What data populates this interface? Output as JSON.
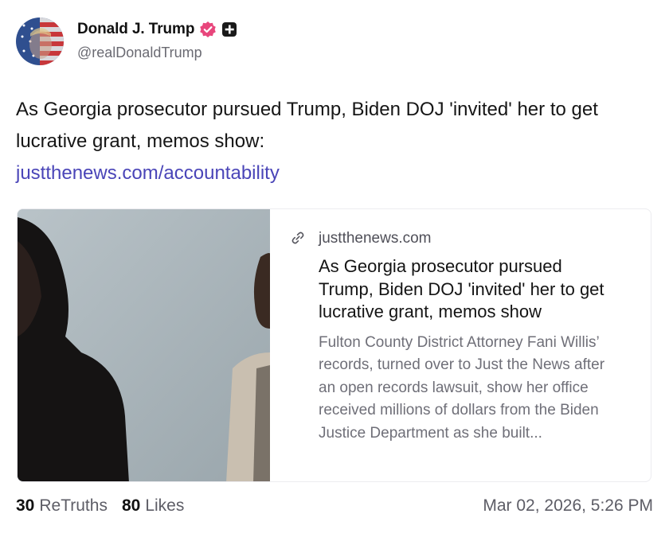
{
  "author": {
    "display_name": "Donald J. Trump",
    "handle": "@realDonaldTrump"
  },
  "post": {
    "text": "As Georgia prosecutor pursued Trump, Biden DOJ 'invited' her to get lucrative grant, memos show:",
    "link": "justthenews.com/accountability"
  },
  "card": {
    "domain": "justthenews.com",
    "title": "As Georgia prosecutor pursued Trump, Biden DOJ 'invited' her to get lucrative grant, memos show",
    "description": "Fulton County District Attorney Fani Willis’ records, turned over to Just the News after an open records lawsuit, show her office received millions of dollars from the Biden Justice Department as she built..."
  },
  "stats": {
    "retruths_count": "30",
    "retruths_label": "ReTruths",
    "likes_count": "80",
    "likes_label": "Likes"
  },
  "timestamp": "Mar 02, 2026, 5:26 PM",
  "colors": {
    "link": "#4a45b8",
    "verified_badge": "#e8467c",
    "muted_text": "#6f6f78"
  },
  "icons": {
    "verified": "verified-badge-icon",
    "plus": "plus-badge-icon",
    "link": "link-icon"
  }
}
